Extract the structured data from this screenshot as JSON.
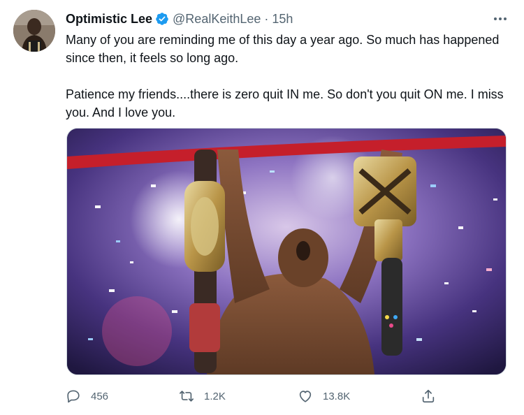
{
  "tweet": {
    "display_name": "Optimistic Lee",
    "handle": "@RealKeithLee",
    "separator": "·",
    "time": "15h",
    "paragraphs": [
      "Many of you are reminding me of this day a year ago. So much has happened since then, it feels so long ago.",
      "Patience my friends....there is zero quit IN me. So don't you quit ON me. I miss you. And I love you."
    ],
    "verified": true
  },
  "actions": {
    "reply_count": "456",
    "retweet_count": "1.2K",
    "like_count": "13.8K"
  },
  "icons": {
    "more": "more-dots-icon",
    "verified": "verified-badge-icon",
    "reply": "reply-icon",
    "retweet": "retweet-icon",
    "like": "heart-icon",
    "share": "share-icon"
  },
  "colors": {
    "verified_blue": "#1d9bf0",
    "muted_text": "#536471",
    "primary_text": "#0f1419"
  }
}
